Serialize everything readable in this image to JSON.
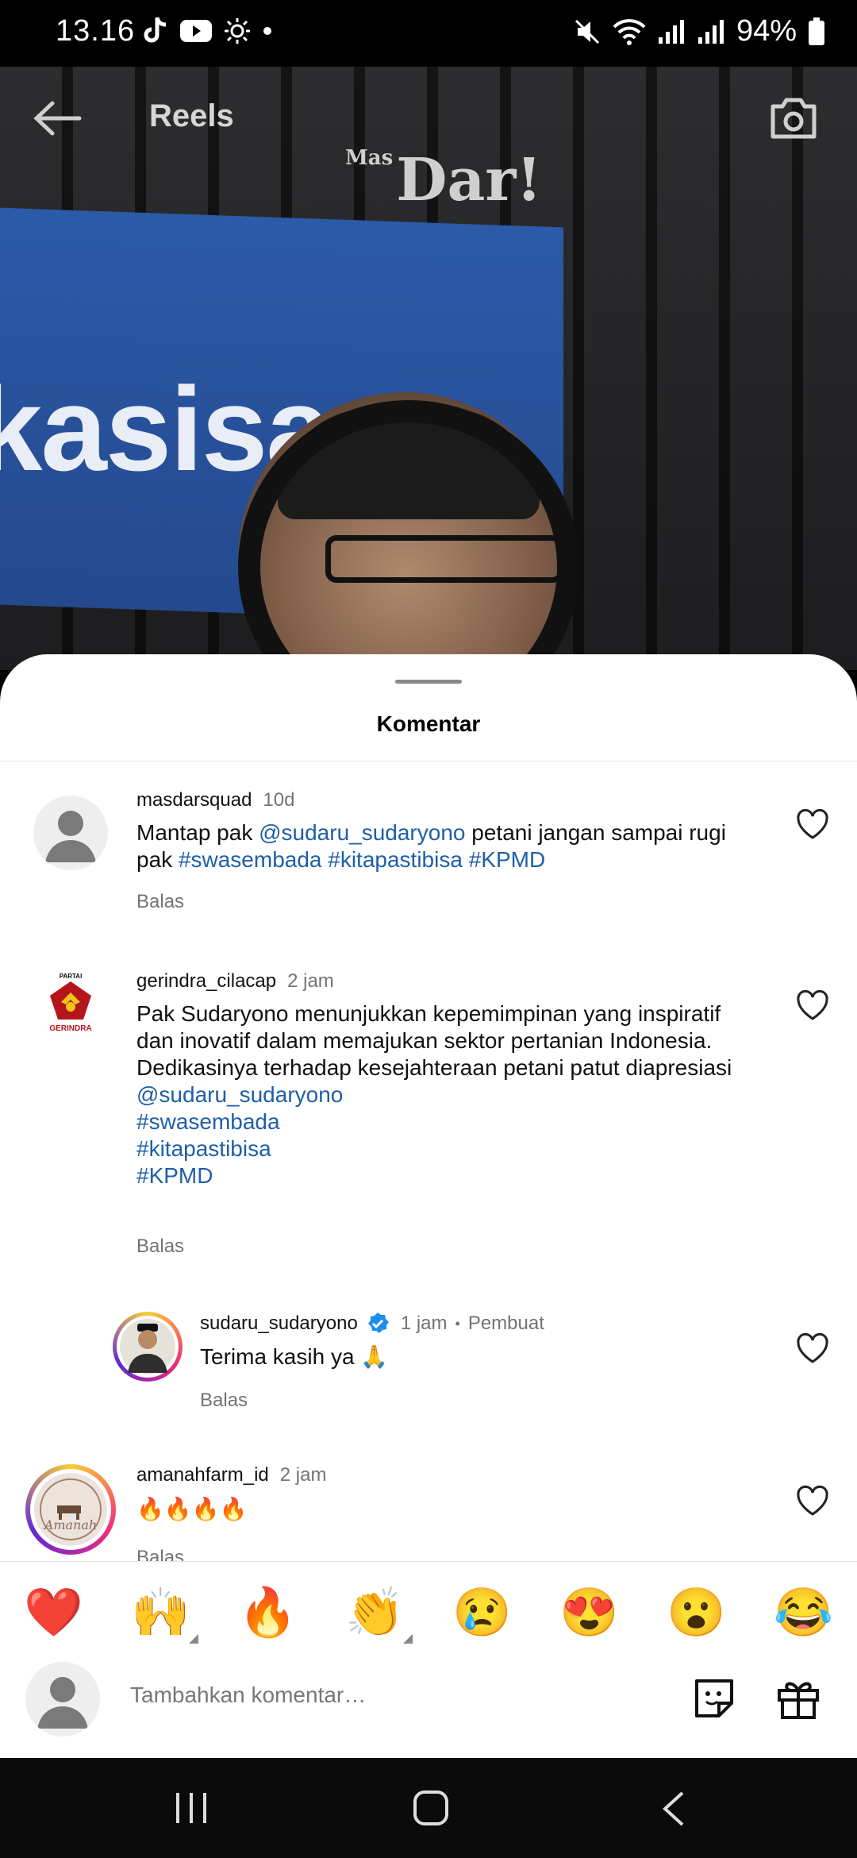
{
  "status_bar": {
    "time": "13.16",
    "battery": "94%"
  },
  "video": {
    "logo_prefix": "Mas",
    "logo_text": "Dar!",
    "wall_text": "kasisa"
  },
  "header": {
    "title": "Reels"
  },
  "sheet": {
    "title": "Komentar"
  },
  "comments": [
    {
      "username": "masdarsquad",
      "time": "10d",
      "text_parts": [
        "Mantap pak ",
        "@sudaru_sudaryono",
        "  petani jangan sampai rugi pak ",
        "#swasembada #kitapastibisa #KPMD"
      ],
      "reply": "Balas"
    },
    {
      "username": "gerindra_cilacap",
      "time": "2 jam",
      "text": "Pak Sudaryono menunjukkan kepemimpinan yang inspiratif dan inovatif dalam memajukan sektor pertanian Indonesia. Dedikasinya terhadap kesejahteraan petani patut diapresiasi",
      "tags": [
        "@sudaru_sudaryono",
        "#swasembada",
        "#kitapastibisa",
        "#KPMD"
      ],
      "avatar_caption_top": "PARTAI",
      "avatar_caption": "GERINDRA",
      "reply": "Balas"
    },
    {
      "username": "sudaru_sudaryono",
      "time": "1 jam",
      "separator": "•",
      "badge": "Pembuat",
      "text": "Terima kasih ya 🙏",
      "reply": "Balas"
    },
    {
      "username": "amanahfarm_id",
      "time": "2 jam",
      "text": "🔥🔥🔥🔥",
      "avatar_caption": "Amanah",
      "reply": "Balas"
    }
  ],
  "emojis": [
    "❤️",
    "🙌",
    "🔥",
    "👏",
    "😢",
    "😍",
    "😮",
    "😂"
  ],
  "add_comment": {
    "placeholder": "Tambahkan komentar…"
  },
  "colors": {
    "link": "#1e5fa8",
    "sheet_bg": "#ffffff",
    "muted": "#737373"
  }
}
